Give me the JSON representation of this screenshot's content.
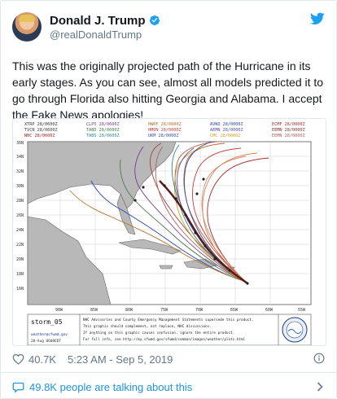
{
  "author": {
    "display_name": "Donald J. Trump",
    "handle": "@realDonaldTrump",
    "verified": true,
    "verified_icon": "verified-badge-icon",
    "brand_icon": "twitter-bird-icon"
  },
  "tweet": {
    "text": "This was the originally projected path of the Hurricane in its early stages. As you can see, almost all models predicted it to go through Florida also hitting Georgia and Alabama. I accept the Fake News apologies!"
  },
  "media": {
    "legend": [
      [
        "XTRP 28/0600Z",
        "CLP5 28/0600Z",
        "HWRF 28/0000Z",
        "AVNO 28/0000Z",
        "ECMF 28/0000Z"
      ],
      [
        "TVCN 28/0600Z",
        "TABD 28/0600Z",
        "HMON 28/0000Z",
        "AEMN 28/0000Z",
        "EEMN 28/0000Z"
      ],
      [
        "NHC 28/0600Z",
        "TABS 28/0600Z",
        "UKM 28/0000Z",
        "CMC 28/0000Z",
        "EEMN 28/0000Z"
      ]
    ],
    "lat_labels": [
      "36N",
      "34N",
      "32N",
      "30N",
      "28N",
      "26N",
      "24N",
      "22N",
      "20N",
      "18N",
      "16N"
    ],
    "lon_labels": [
      "90W",
      "85W",
      "80W",
      "75W",
      "70W",
      "65W",
      "60W",
      "55W"
    ],
    "footer_brand": "storm_05",
    "footer_sub": "weather@sfwmd.gov",
    "footer_date": "28-Aug 0608EDT",
    "footer_text": [
      "NHC Advisories and County Emergency Management Statements supersede this product.",
      "This graphic should complement, not replace, NHC discussions.",
      "If anything on this graphic causes confusion, ignore the entire product.",
      "For full info, see http://my.sfwmd.gov/sfwmd/common/images/weather/plots.html"
    ],
    "colors": {
      "land": "#9a9a9a",
      "track_main": "#5a1a1a",
      "track_alt": "#c86040"
    }
  },
  "meta": {
    "likes": "40.7K",
    "timestamp": "5:23 AM - Sep 5, 2019",
    "like_icon": "heart-icon",
    "info_icon": "info-icon"
  },
  "conversation": {
    "label": "49.8K people are talking about this",
    "icon": "speech-bubble-icon",
    "chevron": "chevron-right-icon"
  },
  "accent_color": "#1b95e0"
}
